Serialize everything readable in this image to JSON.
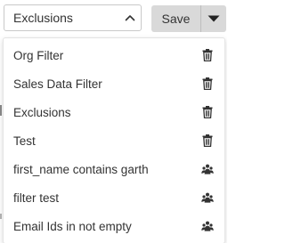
{
  "select": {
    "value": "Exclusions",
    "icon": "chevron-up-icon"
  },
  "save": {
    "label": "Save",
    "caret_icon": "caret-down-icon"
  },
  "menu": {
    "items": [
      {
        "label": "Org Filter",
        "icon": "trash-icon"
      },
      {
        "label": "Sales Data Filter",
        "icon": "trash-icon"
      },
      {
        "label": "Exclusions",
        "icon": "trash-icon"
      },
      {
        "label": "Test",
        "icon": "trash-icon"
      },
      {
        "label": "first_name contains garth",
        "icon": "shared-users-icon"
      },
      {
        "label": "filter test",
        "icon": "shared-users-icon"
      },
      {
        "label": "Email Ids in not empty",
        "icon": "shared-users-icon"
      }
    ]
  },
  "colors": {
    "text": "#333333",
    "button_bg": "#d9d9d9",
    "border": "#c9c9c9"
  }
}
